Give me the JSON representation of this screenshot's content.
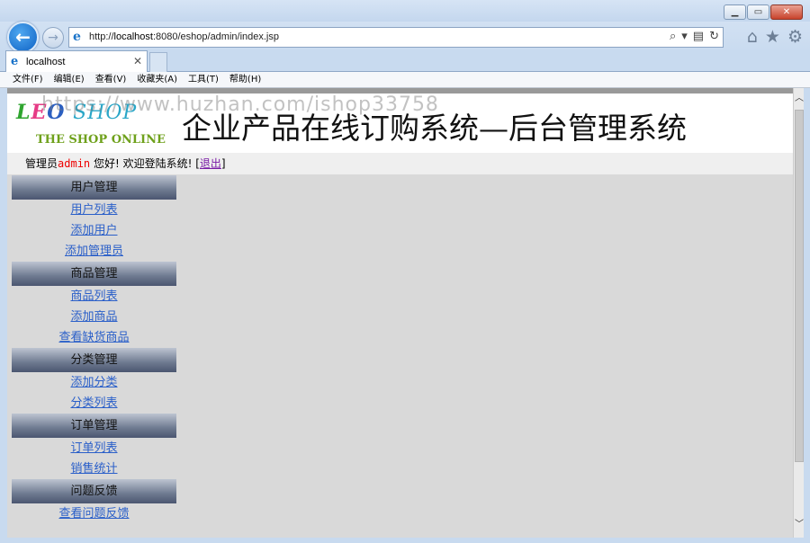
{
  "browser": {
    "url_prefix": "http://",
    "url_host": "localhost",
    "url_rest": ":8080/eshop/admin/index.jsp",
    "tab_title": "localhost",
    "menu": [
      "文件(F)",
      "编辑(E)",
      "查看(V)",
      "收藏夹(A)",
      "工具(T)",
      "帮助(H)"
    ]
  },
  "banner": {
    "logo_main": [
      "L",
      "E",
      "O",
      "SHOP"
    ],
    "logo_sub": "THE SHOP ONLINE",
    "title": "企业产品在线订购系统—后台管理系统",
    "watermark": "https://www.huzhan.com/ishop33758"
  },
  "welcome": {
    "prefix": "管理员",
    "username": "admin",
    "middle": " 您好! 欢迎登陆系统! [",
    "logout": "退出",
    "suffix": "]"
  },
  "sidebar": {
    "sections": [
      {
        "title": "用户管理",
        "links": [
          "用户列表",
          "添加用户",
          "添加管理员"
        ]
      },
      {
        "title": "商品管理",
        "links": [
          "商品列表",
          "添加商品",
          "查看缺货商品"
        ]
      },
      {
        "title": "分类管理",
        "links": [
          "添加分类",
          "分类列表"
        ]
      },
      {
        "title": "订单管理",
        "links": [
          "订单列表",
          "销售统计"
        ]
      },
      {
        "title": "问题反馈",
        "links": [
          "查看问题反馈"
        ]
      }
    ]
  },
  "colors": {
    "link": "#2a5fc9",
    "username": "#ee0000",
    "logout": "#7a1ca6",
    "section_header": "#4b5670"
  }
}
